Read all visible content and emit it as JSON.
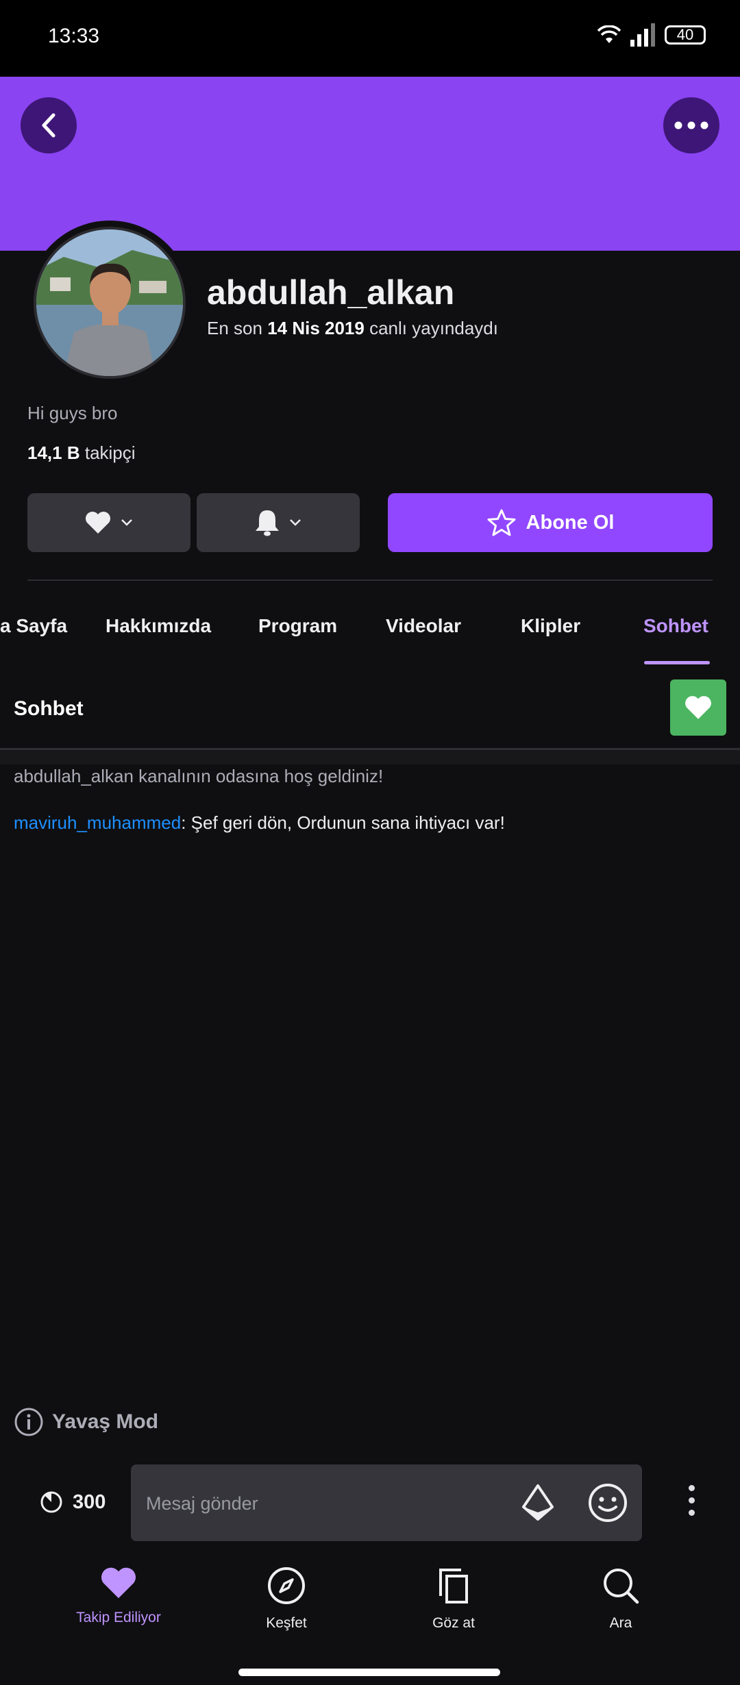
{
  "status_bar": {
    "time": "13:33",
    "battery": "40"
  },
  "profile": {
    "username": "abdullah_alkan",
    "last_live_prefix": "En son",
    "last_live_date": "14 Nis 2019",
    "last_live_suffix": "canlı yayındaydı",
    "bio": "Hi guys bro",
    "followers_count": "14,1 B",
    "followers_label": "takipçi"
  },
  "actions": {
    "subscribe_label": "Abone Ol"
  },
  "tabs": [
    {
      "label": "a Sayfa"
    },
    {
      "label": "Hakkımızda"
    },
    {
      "label": "Program"
    },
    {
      "label": "Videolar"
    },
    {
      "label": "Klipler"
    },
    {
      "label": "Sohbet"
    }
  ],
  "chat": {
    "title": "Sohbet",
    "welcome": "abdullah_alkan kanalının odasına hoş geldiniz!",
    "messages": [
      {
        "user": "maviruh_muhammed",
        "text": ": Şef geri dön, Ordunun sana ihtiyacı var!"
      }
    ],
    "slow_mode": "Yavaş Mod",
    "timer": "300",
    "input_placeholder": "Mesaj gönder"
  },
  "nav": [
    {
      "label": "Takip Ediliyor",
      "icon": "heart-icon"
    },
    {
      "label": "Keşfet",
      "icon": "compass-icon"
    },
    {
      "label": "Göz at",
      "icon": "browse-icon"
    },
    {
      "label": "Ara",
      "icon": "search-icon"
    }
  ],
  "colors": {
    "accent": "#9147ff",
    "banner": "#8a44f2",
    "heart_box": "#4bb561",
    "chat_user": "#1e90ff"
  }
}
